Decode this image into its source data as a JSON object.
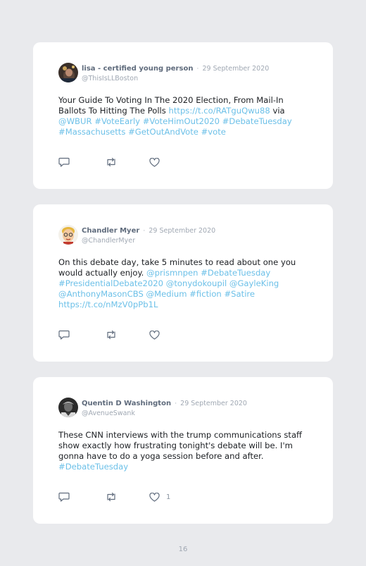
{
  "tweets": [
    {
      "display_name": "lisa - certified young person",
      "separator": "·",
      "date": "29 September 2020",
      "handle": "@ThisIsLLBoston",
      "body": [
        {
          "t": "Your Guide To Voting In The 2020 Election, From Mail-In Ballots To Hitting The Polls ",
          "link": false
        },
        {
          "t": "https://t.co/RATguQwu88",
          "link": true
        },
        {
          "t": " via ",
          "link": false
        },
        {
          "t": "@WBUR #VoteEarly #VoteHimOut2020 #DebateTuesday #Massachusetts #GetOutAndVote #vote",
          "link": true
        }
      ],
      "like_count": ""
    },
    {
      "display_name": "Chandler Myer",
      "separator": "·",
      "date": "29 September 2020",
      "handle": "@ChandlerMyer",
      "body": [
        {
          "t": "On this debate day, take 5 minutes to read about one you would actually enjoy. ",
          "link": false
        },
        {
          "t": "@prismnpen #DebateTuesday #PresidentialDebate2020 @tonydokoupil @GayleKing @AnthonyMasonCBS @Medium #fiction #Satire https://t.co/nMzV0pPb1L",
          "link": true
        }
      ],
      "like_count": ""
    },
    {
      "display_name": "Quentin D Washington",
      "separator": "·",
      "date": "29 September 2020",
      "handle": "@AvenueSwank",
      "body": [
        {
          "t": "These CNN interviews with the trump communications staff show exactly how frustrating tonight's debate will be. I'm gonna have to do a yoga session before and after. ",
          "link": false
        },
        {
          "t": "#DebateTuesday",
          "link": true
        }
      ],
      "like_count": "1"
    }
  ],
  "icons": {
    "reply": "reply-icon",
    "retweet": "retweet-icon",
    "like": "like-icon"
  },
  "colors": {
    "background": "#e9eaed",
    "card": "#ffffff",
    "link": "#6cc0e8",
    "name": "#5f6b7c",
    "meta": "#a0a8b3"
  },
  "page_number": "16"
}
